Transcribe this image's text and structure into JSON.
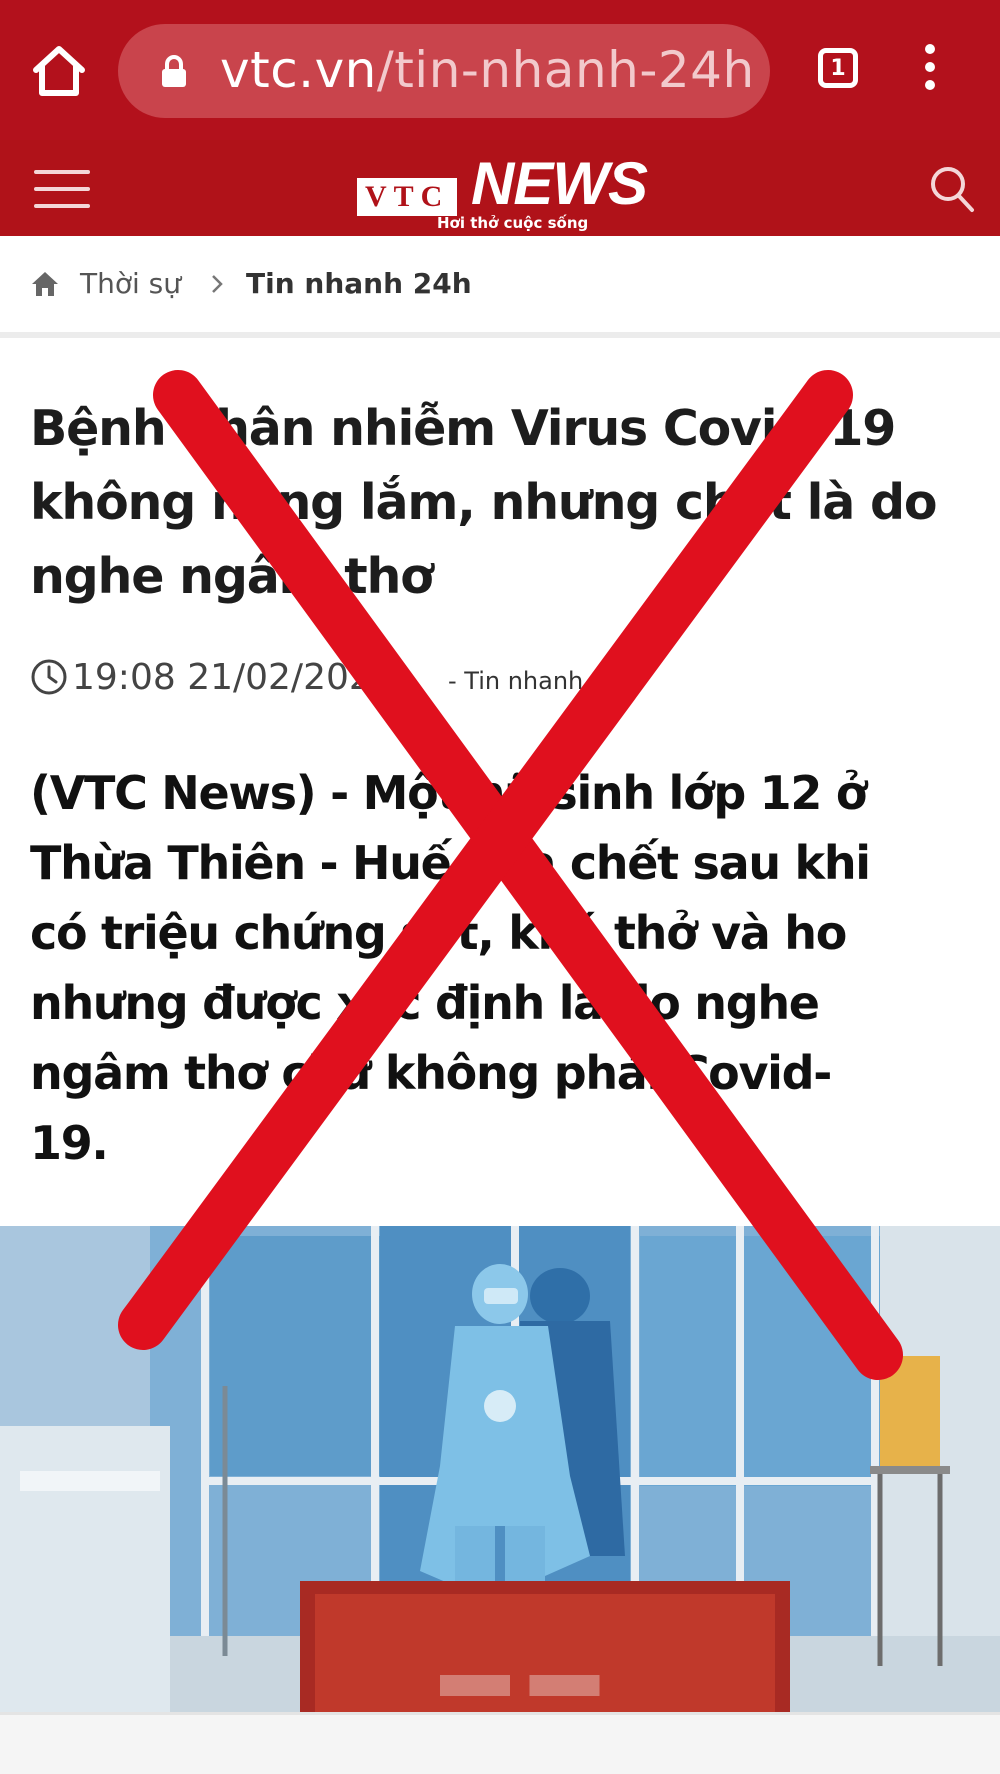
{
  "browser": {
    "url_host": "vtc.vn",
    "url_path": "/tin-nhanh-24h",
    "tab_count": "1",
    "icons": [
      "home-icon",
      "lock-icon",
      "tabs-icon",
      "more-vert-icon"
    ]
  },
  "site": {
    "logo_vtc": "VTC",
    "logo_news": "NEWS",
    "logo_tagline": "Hơi thở cuộc sống",
    "header_color": "#b01219",
    "icons": [
      "menu-icon",
      "search-icon"
    ]
  },
  "breadcrumb": {
    "section": "Thời sự",
    "current": "Tin nhanh 24h"
  },
  "article": {
    "title_lines": [
      "Bệnh nhân nhiễm Virus Covid-19",
      "không nặng lắm, nhưng chết là do",
      "nghe ngâm thơ"
    ],
    "time": "19:08 21/02/2020",
    "category": "- Tin nhanh 24h",
    "lead_lines": [
      "(VTC News) - Một nữ sinh lớp 12 ở",
      "Thừa Thiên - Huế vừa chết sau khi",
      "có triệu chứng sốt, khó thở và ho",
      "nhưng được xác định là do nghe",
      "ngâm thơ chứ không phải Covid-",
      "19."
    ]
  },
  "overlay": {
    "mark": "red-cross-mark",
    "color": "#e0101e"
  }
}
